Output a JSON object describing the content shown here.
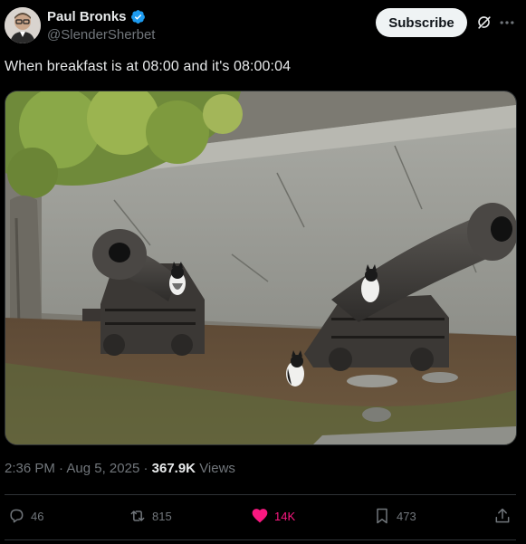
{
  "author": {
    "display_name": "Paul Bronks",
    "handle": "@SlenderSherbet",
    "verified": true
  },
  "header": {
    "subscribe_label": "Subscribe"
  },
  "tweet": {
    "text": "When breakfast is at 08:00 and it's 08:00:04",
    "media_icon": "photo"
  },
  "meta": {
    "time": "2:36 PM",
    "separator": "·",
    "date": "Aug 5, 2025",
    "views_count": "367.9K",
    "views_label": "Views"
  },
  "actions": {
    "replies": "46",
    "reposts": "815",
    "likes": "14K",
    "bookmarks": "473"
  },
  "colors": {
    "background": "#000000",
    "text": "#e7e9ea",
    "muted": "#71767b",
    "verified": "#1d9bf0",
    "like": "#f91880",
    "divider": "#2f3336"
  },
  "icons": {
    "verified": "verified-badge-icon",
    "grok": "grok-icon",
    "more": "more-dots-icon",
    "reply": "reply-icon",
    "repost": "repost-icon",
    "like": "heart-icon",
    "bookmark": "bookmark-icon",
    "share": "share-icon"
  }
}
